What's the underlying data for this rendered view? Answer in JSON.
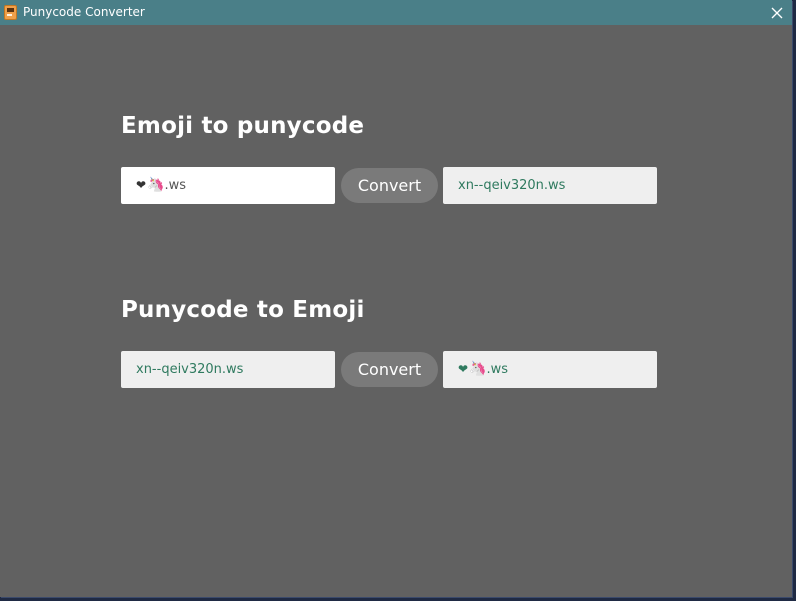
{
  "window": {
    "title": "Punycode Converter",
    "icons": {
      "app": "app-icon",
      "close": "close-icon"
    }
  },
  "emoji_to_punycode": {
    "title": "Emoji to punycode",
    "input_value": "❤🦄.ws",
    "input_heart": "❤",
    "input_unicorn": "🦄",
    "input_suffix": ".ws",
    "button_label": "Convert",
    "output_value": "xn--qeiv320n.ws"
  },
  "punycode_to_emoji": {
    "title": "Punycode to Emoji",
    "input_value": "xn--qeiv320n.ws",
    "button_label": "Convert",
    "output_value": "❤🦄.ws",
    "output_heart": "❤",
    "output_unicorn": "🦄",
    "output_suffix": ".ws"
  },
  "colors": {
    "titlebar": "#4a7f88",
    "window_bg": "#616161",
    "button_bg": "#7a7a7a",
    "output_text": "#2f7a5f"
  }
}
